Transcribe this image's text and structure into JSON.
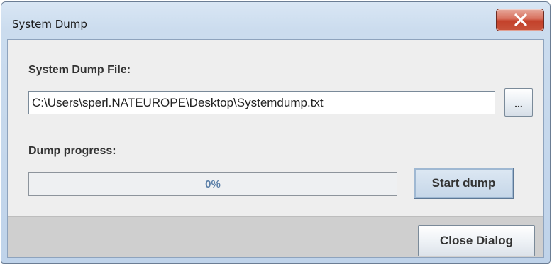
{
  "window": {
    "title": "System Dump"
  },
  "titlebar": {
    "close_icon": "close-x-icon"
  },
  "file": {
    "label": "System Dump File:",
    "path": "C:\\Users\\sperl.NATEUROPE\\Desktop\\Systemdump.txt",
    "browse_label": "..."
  },
  "progress": {
    "label": "Dump progress:",
    "value_percent": 0,
    "text": "0%",
    "start_label": "Start dump"
  },
  "footer": {
    "close_label": "Close Dialog"
  },
  "colors": {
    "titlebar": "#cbdcee",
    "close_button": "#c3412a",
    "progress_text": "#5a7fa8",
    "panel_bg": "#eeeeee",
    "footer_bg": "#cfcfcf"
  }
}
